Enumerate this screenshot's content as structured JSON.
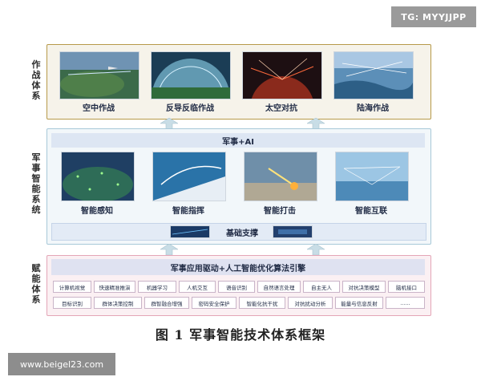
{
  "watermarks": {
    "top": "TG: MYYJJPP",
    "bottom": "www.beigel23.com"
  },
  "side_labels": {
    "combat": [
      "作",
      "战",
      "体",
      "系"
    ],
    "ai": [
      "军",
      "事",
      "智",
      "能",
      "系",
      "统"
    ],
    "enable": [
      "赋",
      "能",
      "体",
      "系"
    ]
  },
  "combat_layer": {
    "items": [
      {
        "label": "空中作战"
      },
      {
        "label": "反导反临作战"
      },
      {
        "label": "太空对抗"
      },
      {
        "label": "陆海作战"
      }
    ]
  },
  "ai_layer": {
    "title": "军事+AI",
    "items": [
      {
        "label": "智能感知"
      },
      {
        "label": "智能指挥"
      },
      {
        "label": "智能打击"
      },
      {
        "label": "智能互联"
      }
    ],
    "base_label": "基础支撑"
  },
  "enable_layer": {
    "title": "军事应用驱动+人工智能优化算法引擎",
    "row1": [
      "计算机视觉",
      "快速精准推演",
      "机器学习",
      "人机交互",
      "语音识别",
      "自然语言处理",
      "自主无人",
      "对抗决策模型",
      "脑机接口"
    ],
    "row2": [
      "目标识别",
      "群体决策控制",
      "群智融合增强",
      "密码安全保护",
      "智能化抗干扰",
      "对抗扰动分析",
      "能量与信息反射",
      "......"
    ]
  },
  "caption": "图 1    军事智能技术体系框架",
  "colors": {
    "combat_border": "#b79a4a",
    "ai_border": "#a8c9d8",
    "enable_border": "#e4a6b7",
    "arrow": "#c8dde6"
  }
}
